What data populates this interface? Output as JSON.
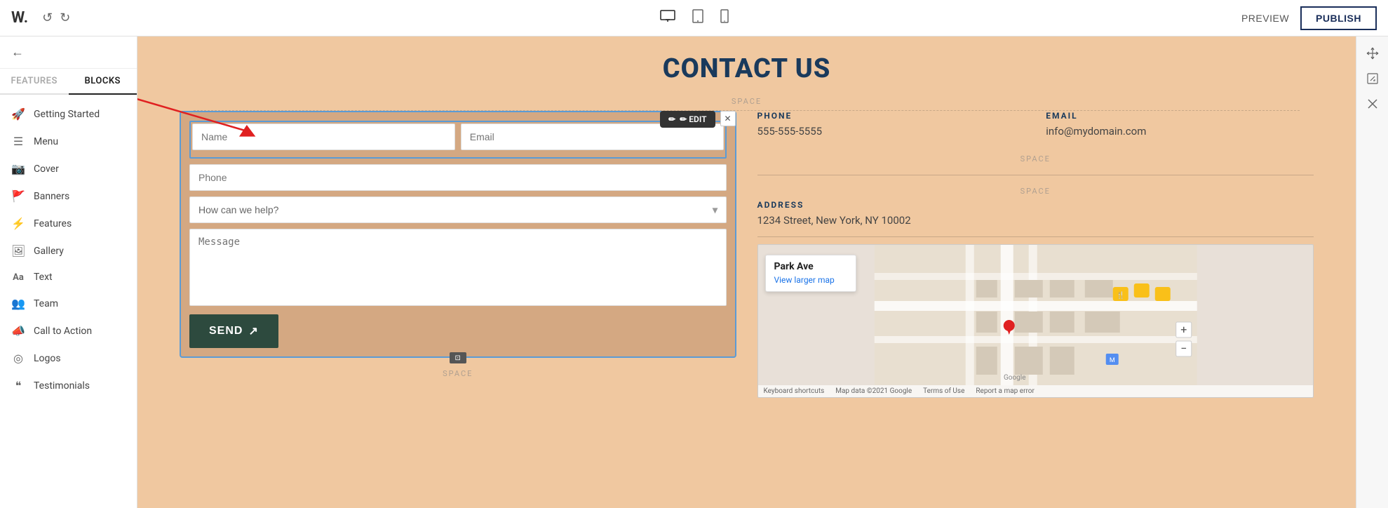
{
  "topbar": {
    "logo": "W.",
    "undo_label": "↺",
    "redo_label": "↻",
    "preview_label": "PREVIEW",
    "publish_label": "PUBLISH",
    "devices": [
      {
        "icon": "desktop",
        "label": "Desktop",
        "active": true
      },
      {
        "icon": "tablet",
        "label": "Tablet",
        "active": false
      },
      {
        "icon": "mobile",
        "label": "Mobile",
        "active": false
      }
    ]
  },
  "sidebar": {
    "tabs": [
      {
        "label": "FEATURES",
        "active": false
      },
      {
        "label": "BLOCKS",
        "active": true
      }
    ],
    "nav_items": [
      {
        "icon": "🚀",
        "label": "Getting Started"
      },
      {
        "icon": "☰",
        "label": "Menu"
      },
      {
        "icon": "📷",
        "label": "Cover"
      },
      {
        "icon": "🚩",
        "label": "Banners"
      },
      {
        "icon": "⚡",
        "label": "Features"
      },
      {
        "icon": "🖼",
        "label": "Gallery"
      },
      {
        "icon": "Aa",
        "label": "Text"
      },
      {
        "icon": "👥",
        "label": "Team"
      },
      {
        "icon": "📣",
        "label": "Call to Action"
      },
      {
        "icon": "◎",
        "label": "Logos"
      },
      {
        "icon": "❝",
        "label": "Testimonials"
      }
    ]
  },
  "page": {
    "title": "CONTACT US",
    "space_label": "SPACE",
    "form": {
      "name_placeholder": "Name",
      "email_placeholder": "Email",
      "phone_placeholder": "Phone",
      "dropdown_placeholder": "How can we help?",
      "message_placeholder": "Message",
      "send_label": "SEND",
      "edit_label": "✏ EDIT"
    },
    "contact_info": {
      "phone_label": "PHONE",
      "phone_value": "555-555-5555",
      "email_label": "EMAIL",
      "email_value": "info@mydomain.com",
      "address_label": "ADDRESS",
      "address_value": "1234 Street, New York, NY 10002"
    },
    "map": {
      "park_ave_label": "Park Ave",
      "view_larger_label": "View larger map"
    }
  },
  "right_panel": {
    "icons": [
      "⊕",
      "⊞",
      "✕"
    ]
  }
}
